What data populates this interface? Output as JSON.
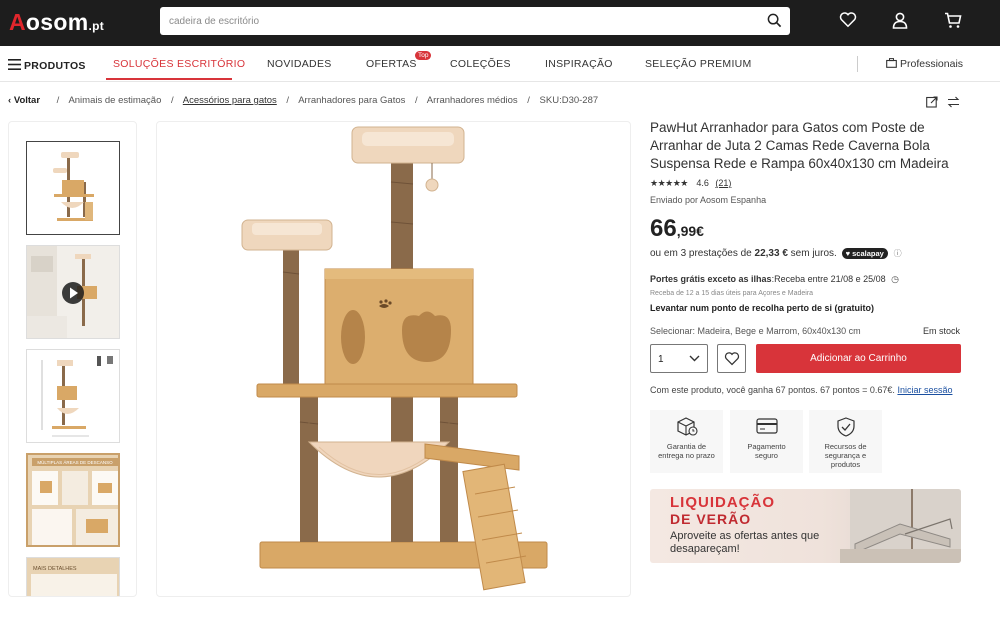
{
  "header": {
    "logo": "Aosom",
    "logo_suffix": ".pt",
    "search_placeholder": "cadeira de escritório"
  },
  "nav": {
    "products": "PRODUTOS",
    "items": [
      "SOLUÇÕES ESCRITÓRIO",
      "NOVIDADES",
      "OFERTAS",
      "COLEÇÕES",
      "INSPIRAÇÃO",
      "SELEÇÃO PREMIUM"
    ],
    "top_badge": "Top",
    "professionals": "Professionais"
  },
  "breadcrumb": {
    "back": "Voltar",
    "items": [
      "Animais de estimação",
      "Acessórios para gatos",
      "Arranhadores para Gatos",
      "Arranhadores médios"
    ],
    "sku": "SKU:D30-287"
  },
  "product": {
    "title": "PawHut Arranhador para Gatos com Poste de Arranhar de Juta 2 Camas Rede Caverna Bola Suspensa Rede e Rampa 60x40x130 cm Madeira",
    "stars": "★★★★★",
    "rating": "4.6",
    "reviews": "(21)",
    "seller": "Enviado por Aosom Espanha",
    "price_int": "66",
    "price_dec": ",99€",
    "installments_pre": "ou em 3 prestações de ",
    "installment_amount": "22,33 €",
    "installments_post": " sem juros.",
    "scalapay": "♥ scalapay",
    "shipping_label": "Portes grátis exceto as ilhas",
    "shipping_dates": ":Receba entre 21/08 e 25/08",
    "islands_note": "Receba de 12 a 15 dias úteis para Açores e Madeira",
    "pickup": "Levantar num ponto de recolha perto de si (gratuito)",
    "select_label": "Selecionar: Madeira, Bege e Marrom, 60x40x130 cm",
    "stock": "Em stock",
    "qty": "1",
    "add_to_cart": "Adicionar ao Carrinho",
    "points_text": "Com este produto, você ganha 67 pontos. 67 pontos = 0.67€. ",
    "login": "Iniciar sessão",
    "features": [
      "Garantia de entrega no prazo",
      "Pagamento seguro",
      "Recursos de segurança e produtos"
    ]
  },
  "banner": {
    "line1": "LIQUIDAÇÃO",
    "line2": "DE  VERÃO",
    "line3": "Aproveite as ofertas antes que desapareçam!"
  },
  "thumbnails": {
    "thumb4_label": "MÚLTIPLAS ÁREAS DE DESCANSO",
    "thumb5_label": "MAIS DETALHES"
  },
  "colors": {
    "accent": "#d8343a",
    "topbar": "#1d1d1d",
    "wood": "#d9a866",
    "sisal": "#8a6a4a",
    "cushion": "#efd7bd"
  }
}
